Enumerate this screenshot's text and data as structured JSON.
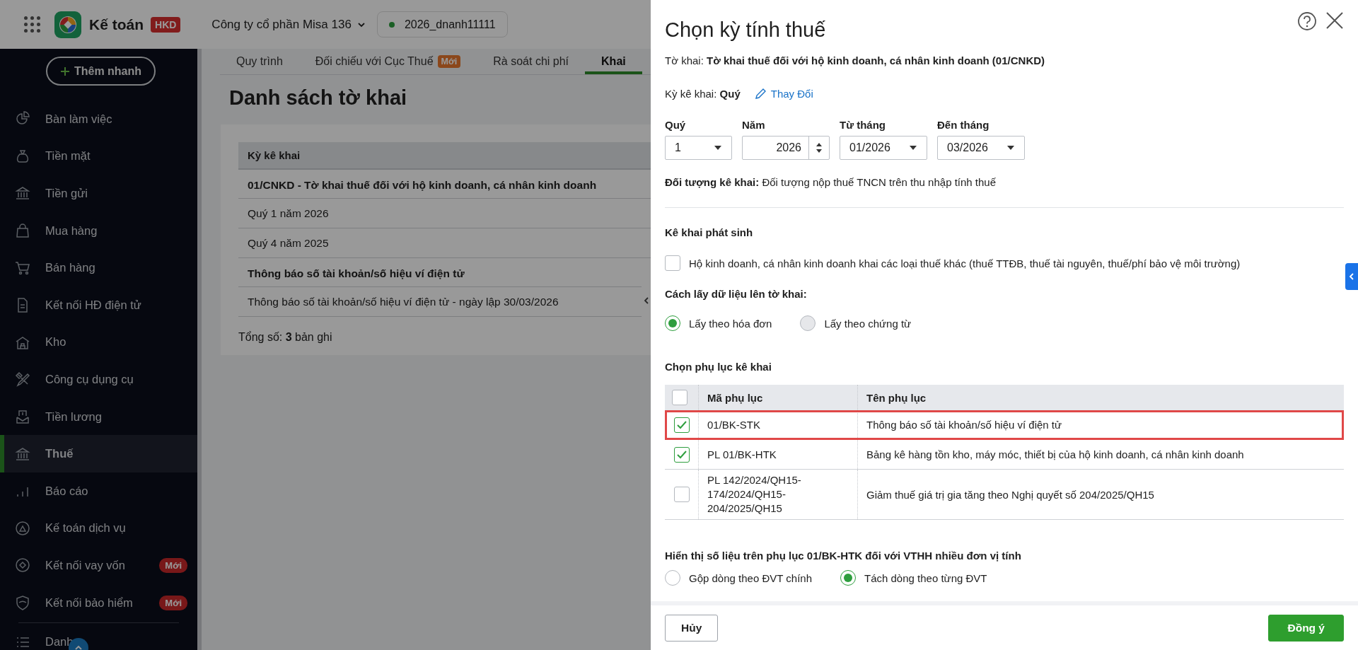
{
  "header": {
    "app_name": "Kế toán",
    "badge": "HKD",
    "company": "Công ty cổ phần Misa 136",
    "database": "2026_dnanh11111"
  },
  "sidebar": {
    "quick_add": "Thêm nhanh",
    "items": [
      {
        "label": "Bàn làm việc",
        "selected": false
      },
      {
        "label": "Tiền mặt",
        "selected": false
      },
      {
        "label": "Tiền gửi",
        "selected": false
      },
      {
        "label": "Mua hàng",
        "selected": false
      },
      {
        "label": "Bán hàng",
        "selected": false
      },
      {
        "label": "Kết nối HĐ điện tử",
        "selected": false
      },
      {
        "label": "Kho",
        "selected": false
      },
      {
        "label": "Công cụ dụng cụ",
        "selected": false
      },
      {
        "label": "Tiền lương",
        "selected": false
      },
      {
        "label": "Thuế",
        "selected": true
      },
      {
        "label": "Báo cáo",
        "selected": false
      },
      {
        "label": "Kế toán dịch vụ",
        "selected": false
      },
      {
        "label": "Kết nối vay vốn",
        "selected": false,
        "badge": "Mới"
      },
      {
        "label": "Kết nối bảo hiểm",
        "selected": false,
        "badge": "Mới"
      },
      {
        "label": "Danh",
        "selected": false
      }
    ]
  },
  "tabs": [
    {
      "label": "Quy trình",
      "selected": false
    },
    {
      "label": "Đối chiếu với Cục Thuế",
      "badge": "Mới",
      "selected": false
    },
    {
      "label": "Rà soát chi phí",
      "selected": false
    },
    {
      "label": "Khai",
      "selected": true
    }
  ],
  "page_title": "Danh sách tờ khai",
  "table": {
    "columns": [
      "Kỳ kê khai"
    ],
    "groups": [
      {
        "title": "01/CNKD - Tờ khai thuế đối với hộ kinh doanh, cá nhân kinh doanh",
        "rows": [
          "Quý 1 năm 2026",
          "Quý 4 năm 2025"
        ]
      },
      {
        "title": "Thông báo số tài khoản/số hiệu ví điện tử",
        "rows": [
          "Thông báo số tài khoản/số hiệu ví điện tử - ngày lập 30/03/2026"
        ]
      }
    ],
    "total": "Tổng số: **3** bản ghi"
  },
  "dialog": {
    "title": "Chọn kỳ tính thuế",
    "declaration": "Tờ khai: **Tờ khai thuế đối với hộ kinh doanh, cá nhân kinh doanh (01/CNKD)**",
    "period": "Kỳ kê khai: **Quý**",
    "change_link": "Thay Đổi",
    "fields": [
      {
        "kind": "select",
        "label": "Quý",
        "value": "1"
      },
      {
        "kind": "spinner",
        "label": "Năm",
        "value": "2026"
      },
      {
        "kind": "select",
        "label": "Từ tháng",
        "value": "01/2026"
      },
      {
        "kind": "select",
        "label": "Đến tháng",
        "value": "03/2026"
      }
    ],
    "subject": "**Đối tượng kê khai:** Đối tượng nộp thuế TNCN trên thu nhập tính thuế",
    "arising": {
      "heading": "Kê khai phát sinh",
      "option": {
        "label": "Hộ kinh doanh, cá nhân kinh doanh khai các loại thuế khác (thuế TTĐB, thuế tài nguyên, thuế/phí bảo vệ môi trường)",
        "checked": false
      }
    },
    "data_source": {
      "heading": "Cách lấy dữ liệu lên tờ khai:",
      "options": [
        {
          "label": "Lấy theo hóa đơn",
          "selected": true,
          "disabled": false
        },
        {
          "label": "Lấy theo chứng từ",
          "selected": false,
          "disabled": true
        }
      ]
    },
    "appendix": {
      "heading": "Chọn phụ lục kê khai",
      "all_checked": false,
      "columns": [
        "Mã phụ lục",
        "Tên phụ lục"
      ],
      "rows": [
        {
          "code": "01/BK-STK",
          "name": "Thông báo số tài khoản/số hiệu ví điện tử",
          "checked": true,
          "highlighted": true
        },
        {
          "code": "PL 01/BK-HTK",
          "name": "Bảng kê hàng tồn kho, máy móc, thiết bị của hộ kinh doanh, cá nhân kinh doanh",
          "checked": true,
          "highlighted": false
        },
        {
          "code": "PL 142/2024/QH15-174/2024/QH15-204/2025/QH15",
          "name": "Giảm thuế giá trị gia tăng theo Nghị quyết số 204/2025/QH15",
          "checked": false,
          "highlighted": false
        }
      ]
    },
    "display": {
      "heading": "Hiển thị số liệu trên phụ lục 01/BK-HTK đối với VTHH nhiều đơn vị tính",
      "options": [
        {
          "label": "Gộp dòng theo ĐVT chính",
          "selected": false,
          "disabled": false
        },
        {
          "label": "Tách dòng theo từng ĐVT",
          "selected": true,
          "disabled": false
        }
      ]
    },
    "buttons": [
      {
        "label": "Hủy",
        "kind": "secondary"
      },
      {
        "label": "Đồng ý",
        "kind": "primary"
      }
    ]
  }
}
